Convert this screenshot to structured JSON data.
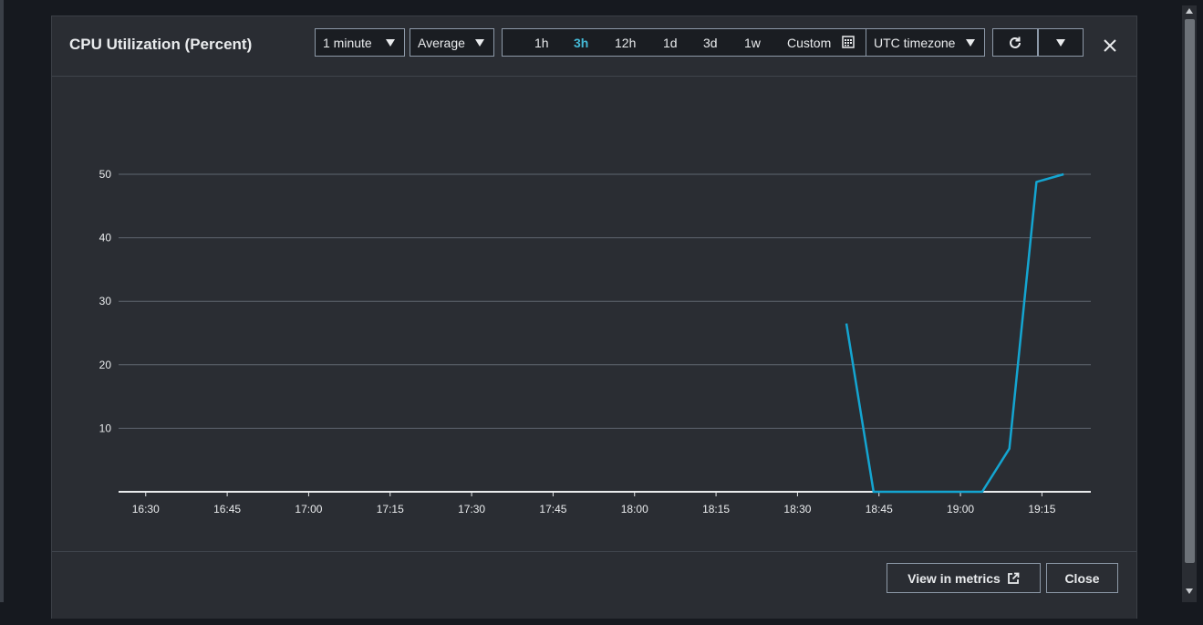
{
  "modal": {
    "title": "CPU Utilization (Percent)",
    "period": {
      "selected": "1 minute"
    },
    "statistic": {
      "selected": "Average"
    },
    "time_range": {
      "items": [
        "1h",
        "3h",
        "12h",
        "1d",
        "3d",
        "1w",
        "Custom"
      ],
      "active": "3h",
      "timezone": "UTC timezone"
    },
    "icons": {
      "calendar": "calendar-icon",
      "refresh": "refresh-icon",
      "more": "caret-down-icon",
      "close": "close-icon",
      "external": "external-link-icon"
    },
    "footer": {
      "view_in_metrics": "View in metrics",
      "close": "Close"
    }
  },
  "colors": {
    "series": "#14a5d1",
    "accent": "#44b9d6",
    "background": "#2a2d33"
  },
  "chart_data": {
    "type": "line",
    "title": "",
    "xlabel": "",
    "ylabel": "",
    "x_ticks": [
      "16:30",
      "16:45",
      "17:00",
      "17:15",
      "17:30",
      "17:45",
      "18:00",
      "18:15",
      "18:30",
      "18:45",
      "19:00",
      "19:15"
    ],
    "y_ticks": [
      10,
      20,
      30,
      40,
      50
    ],
    "xlim": [
      "16:25",
      "19:24"
    ],
    "ylim": [
      0,
      50
    ],
    "grid": true,
    "legend": "none",
    "series": [
      {
        "x": [
          "18:39",
          "18:44",
          "19:04",
          "19:09",
          "19:14",
          "19:19"
        ],
        "y": [
          26.5,
          0,
          0,
          6.8,
          48.8,
          50
        ]
      }
    ]
  }
}
